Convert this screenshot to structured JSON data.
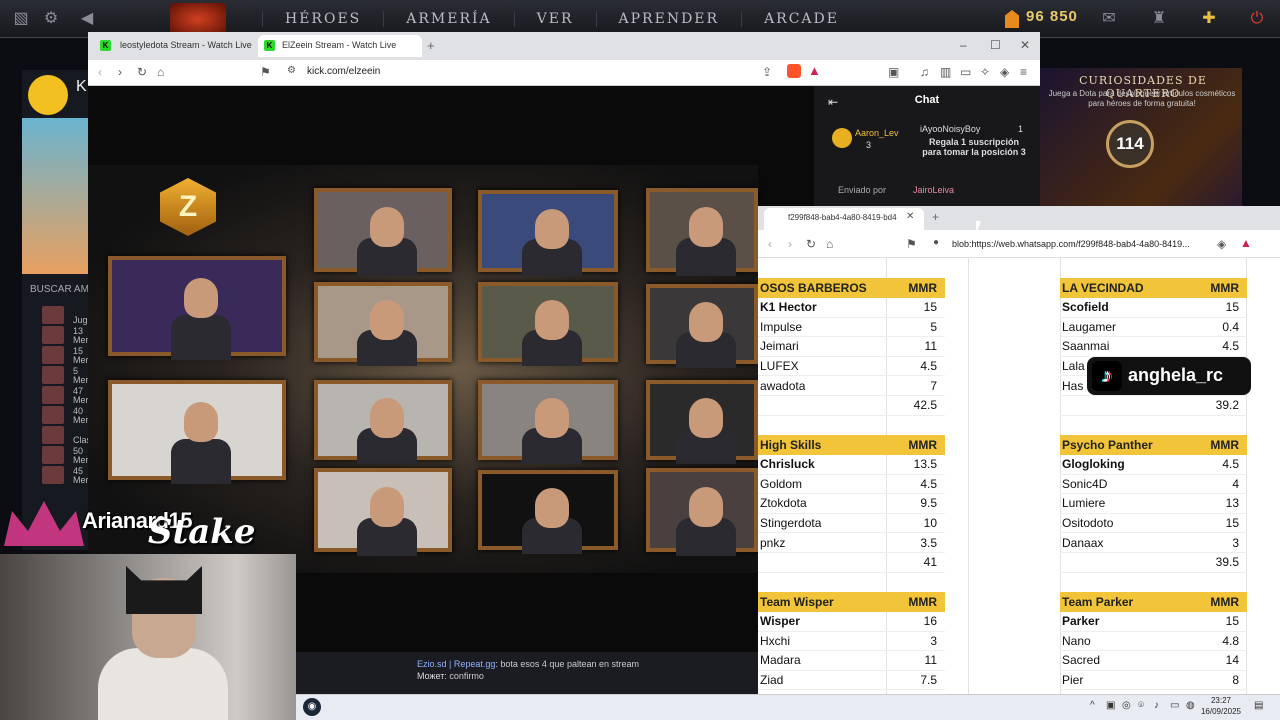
{
  "dota": {
    "nav": [
      "HÉROES",
      "ARMERÍA",
      "VER",
      "APRENDER",
      "ARCADE"
    ],
    "coins": "96 850",
    "quartero_title": "CURIOSIDADES DE QUARTERO",
    "quartero_sub": "Juega a Dota para desbloquear artículos cosméticos para héroes de forma gratuita!",
    "quartero_count": "114",
    "search_label": "BUSCAR AM",
    "friend_labels": [
      "Jug",
      "Mer",
      "Mer",
      "Mer",
      "Mer",
      "Mer",
      "Clas",
      "Mer",
      "Mer"
    ],
    "friend_counts": [
      "",
      "13",
      "15",
      "5",
      "47",
      "40",
      "",
      "50",
      "45"
    ]
  },
  "browser1": {
    "tabs": [
      "leostyledota Stream - Watch Live",
      "ElZeein Stream - Watch Live"
    ],
    "url": "kick.com/elzeein",
    "new_tab": "+"
  },
  "kick_chat": {
    "title": "Chat",
    "user1": "Aaron_Lev",
    "user1_num": "3",
    "user2": "iAyooNoisyBoy",
    "user2_num": "1",
    "gift_msg": "Regala 1 suscripción para tomar la posición 3",
    "sent_by_label": "Enviado por",
    "sent_by_user": "JairoLeiva"
  },
  "stream_overlay": {
    "line1_user": "Ezio.sd | Repeat.gg",
    "line1_msg": ": bota esos 4 que paltean en stream",
    "line2_user": "Может",
    "line2_msg": ": confirmo"
  },
  "browser2": {
    "tab": "f299f848-bab4-4a80-8419-bd4",
    "url": "blob:https://web.whatsapp.com/f299f848-bab4-4a80-8419..."
  },
  "teams": [
    {
      "name": "OSOS BARBEROS",
      "header": "MMR",
      "players": [
        [
          "K1 Hector",
          "15"
        ],
        [
          "Impulse",
          "5"
        ],
        [
          "Jeimari",
          "11"
        ],
        [
          "LUFEX",
          "4.5"
        ],
        [
          "awadota",
          "7"
        ]
      ],
      "total": "42.5"
    },
    {
      "name": "LA VECINDAD",
      "header": "MMR",
      "players": [
        [
          "Scofield",
          "15"
        ],
        [
          "Laugamer",
          "0.4"
        ],
        [
          "Saanmai",
          "4.5"
        ],
        [
          "Lala",
          ""
        ],
        [
          "Has",
          ""
        ]
      ],
      "total": "39.2"
    },
    {
      "name": "High Skills",
      "header": "MMR",
      "players": [
        [
          "Chrisluck",
          "13.5"
        ],
        [
          "Goldom",
          "4.5"
        ],
        [
          "Ztokdota",
          "9.5"
        ],
        [
          "Stingerdota",
          "10"
        ],
        [
          "pnkz",
          "3.5"
        ]
      ],
      "total": "41"
    },
    {
      "name": "Psycho Panther",
      "header": "MMR",
      "players": [
        [
          "Glogloking",
          "4.5"
        ],
        [
          "Sonic4D",
          "4"
        ],
        [
          "Lumiere",
          "13"
        ],
        [
          "Ositodoto",
          "15"
        ],
        [
          "Danaax",
          "3"
        ]
      ],
      "total": "39.5"
    },
    {
      "name": "Team Wisper",
      "header": "MMR",
      "players": [
        [
          "Wisper",
          "16"
        ],
        [
          "Hxchi",
          "3"
        ],
        [
          "Madara",
          "11"
        ],
        [
          "Ziad",
          "7.5"
        ]
      ],
      "total": ""
    },
    {
      "name": "Team Parker",
      "header": "MMR",
      "players": [
        [
          "Parker",
          "15"
        ],
        [
          "Nano",
          "4.8"
        ],
        [
          "Sacred",
          "14"
        ],
        [
          "Pier",
          "8"
        ]
      ],
      "total": ""
    }
  ],
  "overlay": {
    "tiktok_handle": "anghela_rc",
    "arianna": "Arianard15",
    "stake": "Stake"
  },
  "taskbar": {
    "time": "23:27",
    "date": "16/09/2025"
  }
}
